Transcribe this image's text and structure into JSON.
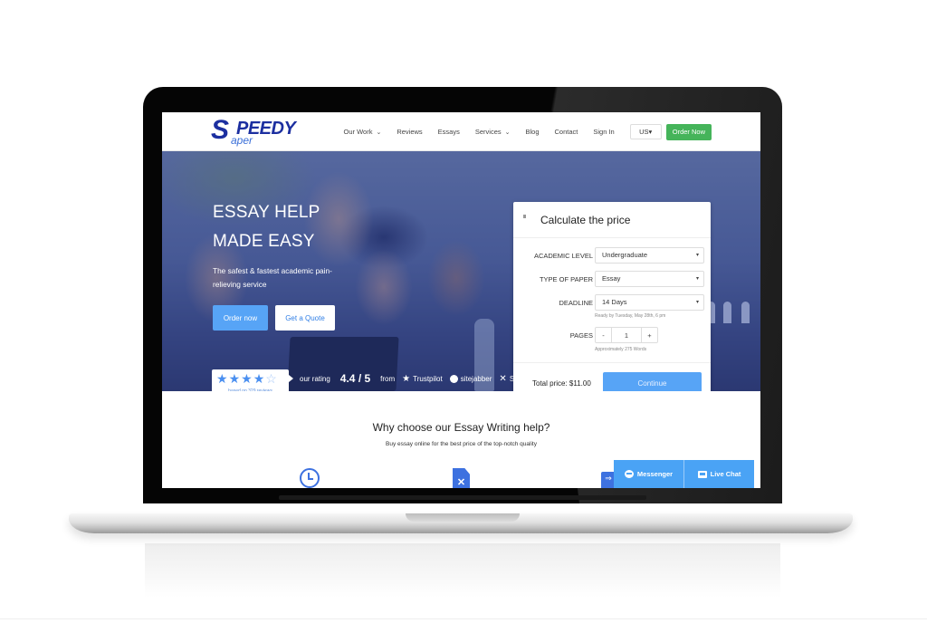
{
  "header": {
    "logo": {
      "s": "S",
      "eedy": "PEEDY",
      "paper": "aper"
    },
    "nav": [
      {
        "label": "Our Work",
        "has_dropdown": true
      },
      {
        "label": "Reviews",
        "has_dropdown": false
      },
      {
        "label": "Essays",
        "has_dropdown": false
      },
      {
        "label": "Services",
        "has_dropdown": true
      },
      {
        "label": "Blog",
        "has_dropdown": false
      },
      {
        "label": "Contact",
        "has_dropdown": false
      },
      {
        "label": "Sign In",
        "has_dropdown": false
      }
    ],
    "chevron": "⌄",
    "language": "US▾",
    "order_now": "Order Now",
    "order_now_color": "#45b45a"
  },
  "hero": {
    "title_line1": "ESSAY HELP",
    "title_line2": "MADE EASY",
    "subtitle": "The safest & fastest academic pain-relieving service",
    "order_button": "Order now",
    "quote_button": "Get a Quote",
    "accent_color": "#57a4f6"
  },
  "rating": {
    "stars_filled": 4,
    "stars_total": 5,
    "star_glyph": "★",
    "half_star_glyph": "☆",
    "based_on": "based on 329 reviews",
    "our_rating_label": "our rating",
    "score": "4.4 / 5",
    "from_label": "from",
    "sources": [
      {
        "icon": "star-icon",
        "glyph": "★",
        "label": "Trustpilot"
      },
      {
        "icon": "sitejabber-icon",
        "glyph": "",
        "label": "sitejabber"
      },
      {
        "icon": "scamfighter-icon",
        "glyph": "✕",
        "label": "ScamFighter"
      }
    ]
  },
  "calculator": {
    "title": "Calculate the price",
    "fields": {
      "academic_level": {
        "label": "ACADEMIC LEVEL",
        "value": "Undergraduate"
      },
      "type_of_paper": {
        "label": "TYPE OF PAPER",
        "value": "Essay"
      },
      "deadline": {
        "label": "DEADLINE",
        "value": "14 Days",
        "hint": "Ready by Tuesday, May 28th, 6 pm"
      },
      "pages": {
        "label": "PAGES",
        "value": "1",
        "minus": "-",
        "plus": "+",
        "hint": "Approximately 275 Words"
      }
    },
    "caret": "▾",
    "total": "Total price: $11.00",
    "continue": "Continue"
  },
  "why": {
    "title": "Why choose our Essay Writing help?",
    "subtitle": "Buy essay online for the best price of the top-notch quality"
  },
  "chat": {
    "messenger": "Messenger",
    "live_chat": "Live Chat",
    "color": "#4aa3f5"
  }
}
